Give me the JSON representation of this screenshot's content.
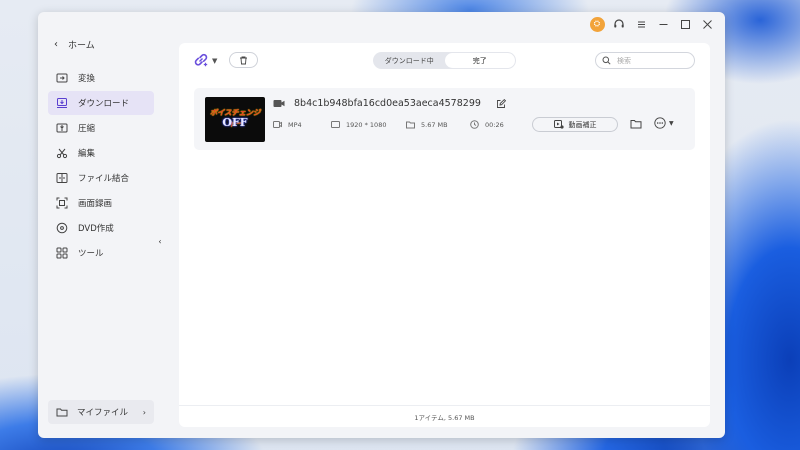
{
  "sidebar": {
    "back_label": "ホーム",
    "items": [
      {
        "label": "変換",
        "icon": "convert-icon",
        "active": false
      },
      {
        "label": "ダウンロード",
        "icon": "download-icon",
        "active": true
      },
      {
        "label": "圧縮",
        "icon": "compress-icon",
        "active": false
      },
      {
        "label": "編集",
        "icon": "scissors-icon",
        "active": false
      },
      {
        "label": "ファイル結合",
        "icon": "merge-icon",
        "active": false
      },
      {
        "label": "画面録画",
        "icon": "screen-record-icon",
        "active": false
      },
      {
        "label": "DVD作成",
        "icon": "dvd-icon",
        "active": false
      },
      {
        "label": "ツール",
        "icon": "toolbox-icon",
        "active": false
      }
    ],
    "my_files_label": "マイファイル"
  },
  "toolbar": {
    "tabs": [
      {
        "label": "ダウンロード中",
        "selected": false
      },
      {
        "label": "完了",
        "selected": true
      }
    ],
    "search_placeholder": "検索"
  },
  "item": {
    "filename": "8b4c1b948bfa16cd0ea53aeca4578299",
    "thumbnail_text_1": "ボイスチェンジャー",
    "thumbnail_text_2": "OFF",
    "format": "MP4",
    "resolution": "1920 * 1080",
    "size": "5.67 MB",
    "duration": "00:26",
    "fix_button_label": "動画補正"
  },
  "status_bar": "1アイテム, 5.67 MB",
  "colors": {
    "accent": "#7b5fe0",
    "active_nav_bg": "#e6e3f6",
    "avatar": "#f2a33a"
  }
}
